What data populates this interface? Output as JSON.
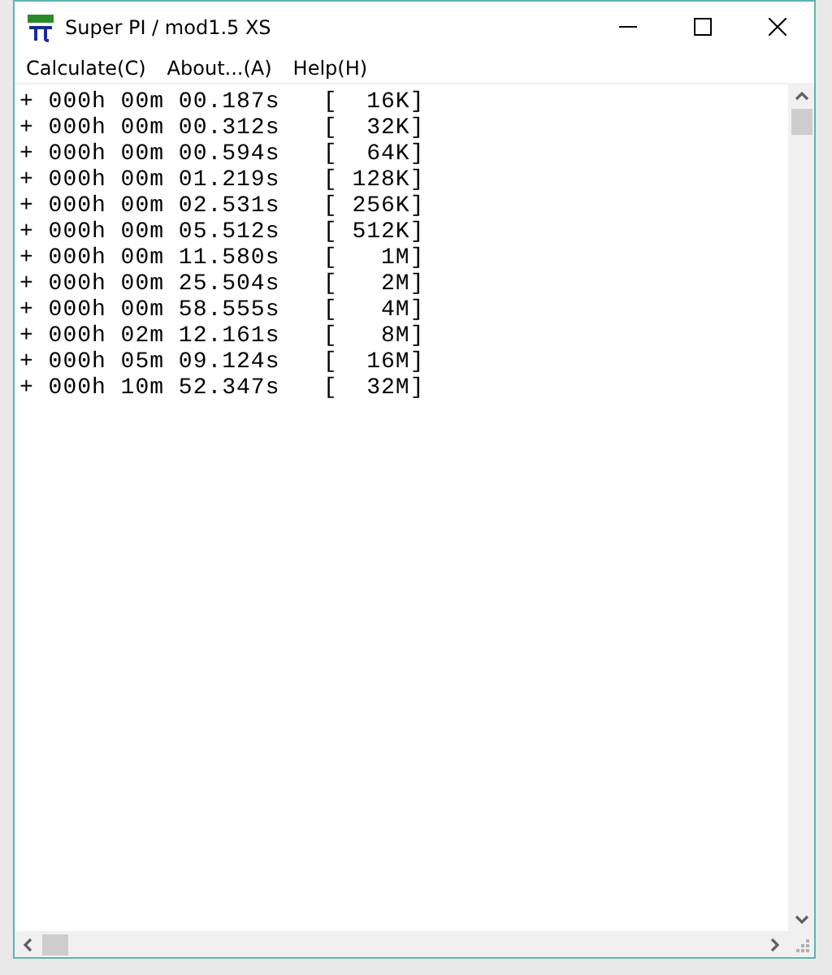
{
  "window": {
    "title": "Super PI / mod1.5 XS"
  },
  "menu": [
    {
      "label": "Calculate(C)"
    },
    {
      "label": "About...(A)"
    },
    {
      "label": "Help(H)"
    }
  ],
  "output": {
    "lines": [
      "+ 000h 00m 00.187s   [  16K]",
      "+ 000h 00m 00.312s   [  32K]",
      "+ 000h 00m 00.594s   [  64K]",
      "+ 000h 00m 01.219s   [ 128K]",
      "+ 000h 00m 02.531s   [ 256K]",
      "+ 000h 00m 05.512s   [ 512K]",
      "+ 000h 00m 11.580s   [   1M]",
      "+ 000h 00m 25.504s   [   2M]",
      "+ 000h 00m 58.555s   [   4M]",
      "+ 000h 02m 12.161s   [   8M]",
      "+ 000h 05m 09.124s   [  16M]",
      "+ 000h 10m 52.347s   [  32M]"
    ]
  }
}
